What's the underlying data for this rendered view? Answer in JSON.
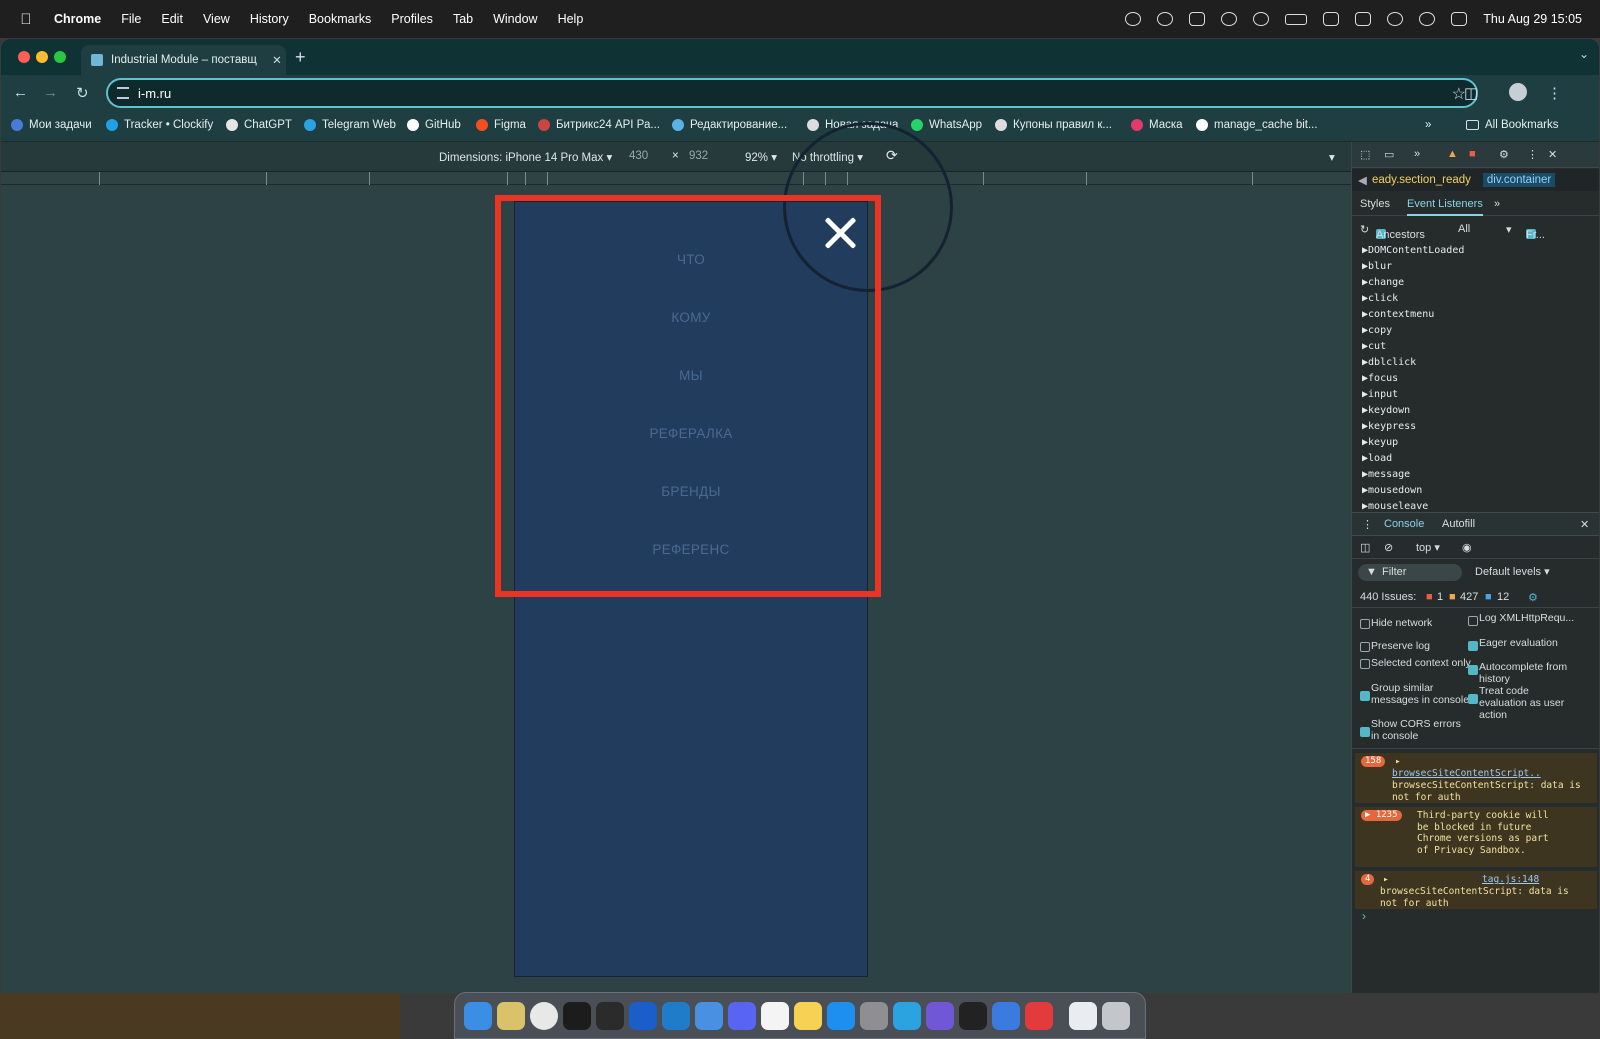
{
  "menubar": {
    "app": "Chrome",
    "items": [
      "File",
      "Edit",
      "View",
      "History",
      "Bookmarks",
      "Profiles",
      "Tab",
      "Window",
      "Help"
    ],
    "clock": "Thu Aug 29  15:05"
  },
  "tab": {
    "title": "Industrial Module – поставщ",
    "close": "✕",
    "new_tab": "+"
  },
  "address": {
    "url": "i-m.ru"
  },
  "bookmarks": {
    "items": [
      "Мои задачи",
      "Tracker • Clockify",
      "ChatGPT",
      "Telegram Web",
      "GitHub",
      "Figma",
      "Битрикс24 API Ра...",
      "Редактирование...",
      "Новая задача",
      "WhatsApp",
      "Купоны правил к...",
      "Маска",
      "manage_cache bit..."
    ],
    "all": "All Bookmarks",
    "more": "»"
  },
  "device_toolbar": {
    "dimensions": "Dimensions: iPhone 14 Pro Max ▾",
    "width": "430",
    "x": "×",
    "height": "932",
    "zoom": "92% ▾",
    "throttle": "No throttling ▾"
  },
  "mobile_menu": {
    "items": [
      "ЧТО",
      "КОМУ",
      "МЫ",
      "РЕФЕРАЛКА",
      "БРЕНДЫ",
      "РЕФЕРЕНС"
    ],
    "colors": {
      "background": "#223c5e",
      "item_text": "#4a6a8f",
      "highlight": "#ea3322"
    }
  },
  "devtools": {
    "breadcrumb": [
      "eady.section_ready",
      "div.container"
    ],
    "tabs": [
      "Styles",
      "Event Listeners",
      "»"
    ],
    "ancestors": "Ancestors",
    "ancestors_value": "All",
    "framework": "Fr...",
    "events": [
      "DOMContentLoaded",
      "blur",
      "change",
      "click",
      "contextmenu",
      "copy",
      "cut",
      "dblclick",
      "focus",
      "input",
      "keydown",
      "keypress",
      "keyup",
      "load",
      "message",
      "mousedown",
      "mouseleave"
    ],
    "console_tabs": [
      "Console",
      "Autofill"
    ],
    "context": "top ▾",
    "filter": "Filter",
    "levels": "Default levels ▾",
    "issues": "440 Issues:",
    "issue_counts": [
      "1",
      "427",
      "12"
    ],
    "settings_left": [
      "Hide network",
      "Preserve log",
      "Selected context only",
      "Group similar messages in console",
      "Show CORS errors in console"
    ],
    "settings_right": [
      "Log XMLHttpRequ...",
      "Eager evaluation",
      "Autocomplete from history",
      "Treat code evaluation as user action"
    ],
    "messages": [
      {
        "count": "158",
        "link": "browsecSiteContentScript..",
        "text": "browsecSiteContentScript: data is not for auth"
      },
      {
        "count": "▶ 1235",
        "link": "",
        "text": "Third-party cookie will be blocked in future Chrome versions as part of Privacy Sandbox."
      },
      {
        "count": "4",
        "link": "tag.js:148",
        "text": "browsecSiteContentScript: data is not for auth"
      }
    ],
    "prompt": "›"
  }
}
